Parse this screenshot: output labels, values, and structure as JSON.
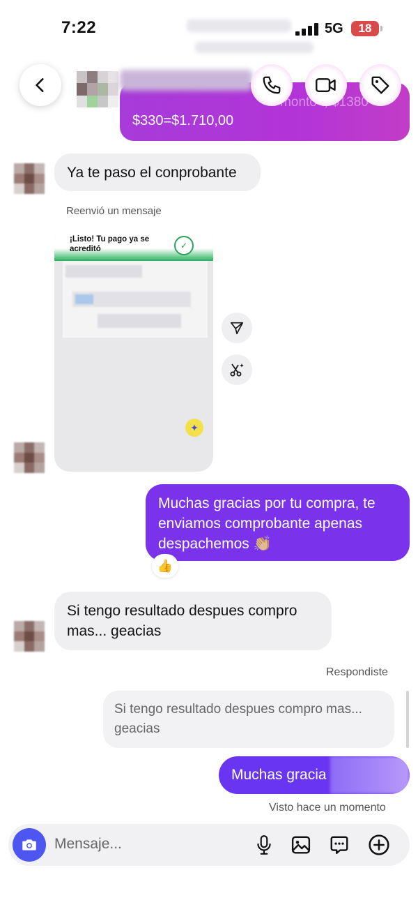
{
  "status_bar": {
    "time": "7:22",
    "network": "5G",
    "battery": "18"
  },
  "header": {
    "back_icon": "chevron-left-icon",
    "actions": [
      "phone-icon",
      "video-icon",
      "tag-icon"
    ]
  },
  "messages": {
    "top_outgoing_line": "$330=$1.710,00",
    "top_outgoing_partial": "al monto t, $1380 +",
    "incoming_1": "Ya te paso el conprobante",
    "forward_label": "Reenvió un mensaje",
    "forwarded_card_title": "¡Listo! Tu pago ya se acreditó",
    "outgoing_1": "Muchas gracias por tu compra, te enviamos comprobante apenas despachemos 👏🏼",
    "reaction": "👍",
    "incoming_2": "Si tengo resultado despues compro mas... geacias",
    "replied_label": "Respondiste",
    "quoted_text": "Si tengo resultado despues compro mas... geacias",
    "last_outgoing": "Muchas gracia",
    "seen_label": "Visto hace un momento"
  },
  "composer": {
    "placeholder": "Mensaje...",
    "icons": [
      "camera-icon",
      "microphone-icon",
      "image-icon",
      "sticker-icon",
      "plus-icon"
    ]
  },
  "colors": {
    "outgoing": "#7a33ea",
    "camera_button": "#4d56f0",
    "incoming": "#efeff2"
  }
}
